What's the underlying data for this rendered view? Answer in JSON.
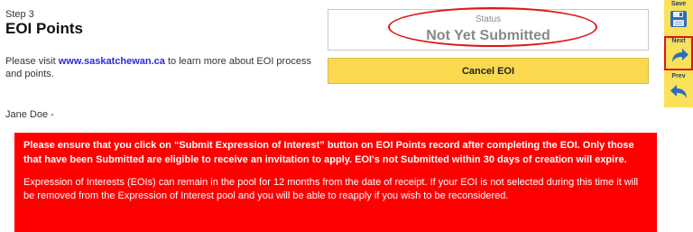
{
  "header": {
    "step": "Step 3",
    "title": "EOI Points"
  },
  "intro": {
    "before_link": "Please visit ",
    "link_text": "www.saskatchewan.ca",
    "after_link": " to learn more about EOI process and points."
  },
  "status": {
    "label": "Status",
    "value": "Not Yet Submitted"
  },
  "actions": {
    "cancel_label": "Cancel EOI"
  },
  "user": {
    "name": "Jane Doe -"
  },
  "alert": {
    "strong_text": "Please ensure that you click on “Submit Expression of Interest” button on EOI Points record after completing the EOI. Only those that have been Submitted are eligible to receive an invitation to apply. EOI's not Submitted within 30 days of creation will expire.",
    "normal_text": "Expression of Interests (EOIs) can remain in the pool for 12 months from the date of receipt. If your EOI is not selected during this time it will be removed from the Expression of Interest pool and you will be able to reapply if you wish to be reconsidered."
  },
  "toolbar": {
    "save_label": "Save",
    "next_label": "Next",
    "prev_label": "Prev",
    "save_icon": "floppy-disk-icon",
    "next_icon": "arrow-forward-icon",
    "prev_icon": "arrow-back-icon"
  },
  "colors": {
    "alert_bg": "#ff0000",
    "button_yellow": "#fbd94f",
    "toolbar_yellow": "#fbe15a",
    "highlight_red": "#e01515",
    "link_blue": "#2a2ae0",
    "icon_blue": "#2b6fb8"
  }
}
